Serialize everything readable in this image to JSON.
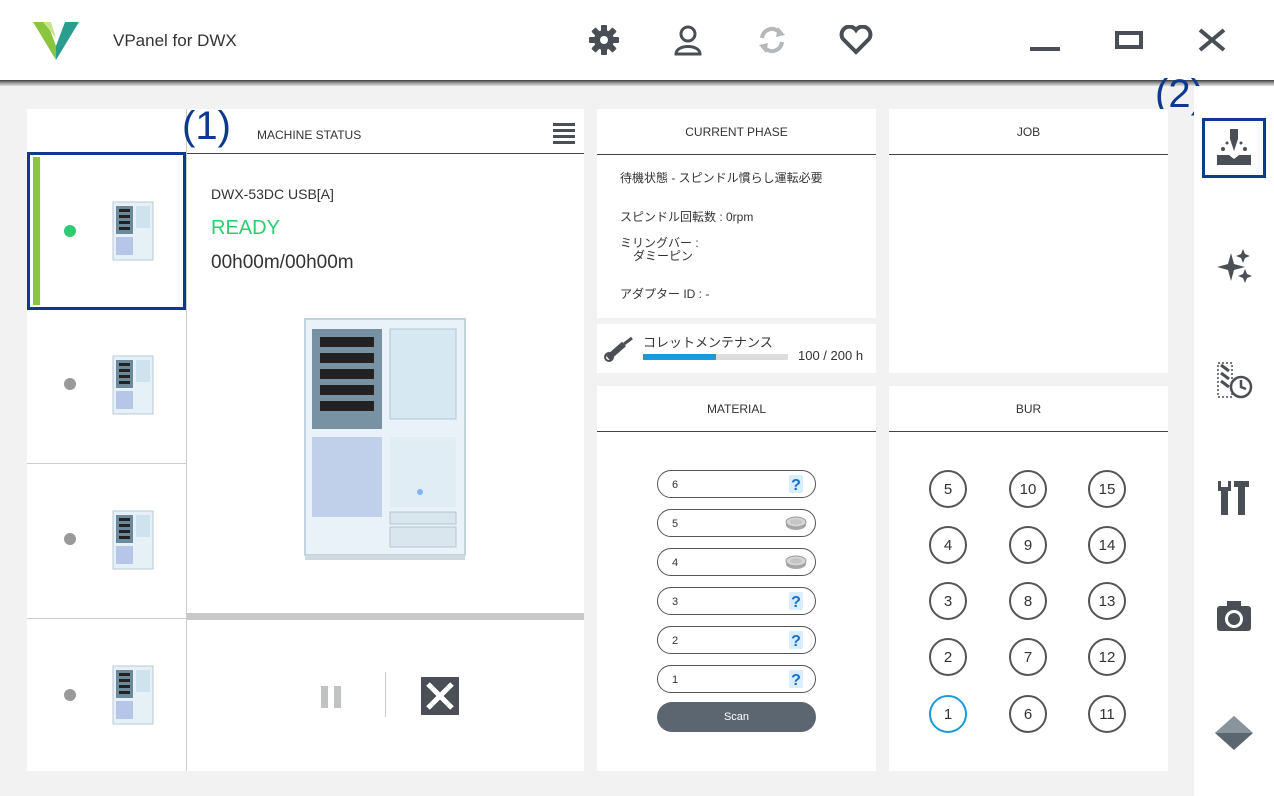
{
  "app": {
    "title": "VPanel for DWX"
  },
  "annotations": {
    "one": "(1)",
    "two": "(2)"
  },
  "toolbar": {
    "icons": [
      "gear-icon",
      "user-icon",
      "sync-icon",
      "heart-icon"
    ]
  },
  "window_controls": [
    "minimize-icon",
    "maximize-icon",
    "close-icon"
  ],
  "machine_status": {
    "title": "MACHINE STATUS",
    "model": "DWX-53DC USB[A]",
    "state": "READY",
    "state_color": "#2ecc71",
    "time": "00h00m/00h00m",
    "progress": 0
  },
  "machines": [
    {
      "status": "active",
      "color": "#2ecc71"
    },
    {
      "status": "idle",
      "color": "#9a9a9a"
    },
    {
      "status": "idle",
      "color": "#9a9a9a"
    },
    {
      "status": "idle",
      "color": "#9a9a9a"
    }
  ],
  "current_phase": {
    "title": "CURRENT PHASE",
    "state": "待機状態 - スピンドル慣らし運転必要",
    "spindle": "スピンドル回転数 : 0rpm",
    "milling_bar_label": "ミリングバー :",
    "milling_bar_value": "ダミーピン",
    "adapter": "アダプター ID : -"
  },
  "collet": {
    "label": "コレットメンテナンス",
    "value": "100 / 200 h",
    "fraction": 0.5
  },
  "job": {
    "title": "JOB"
  },
  "material": {
    "title": "MATERIAL",
    "slots": [
      {
        "num": "6",
        "icon": "question-icon"
      },
      {
        "num": "5",
        "icon": "disc-icon"
      },
      {
        "num": "4",
        "icon": "disc-icon"
      },
      {
        "num": "3",
        "icon": "question-icon"
      },
      {
        "num": "2",
        "icon": "question-icon"
      },
      {
        "num": "1",
        "icon": "question-icon"
      }
    ],
    "scan_label": "Scan"
  },
  "bur": {
    "title": "BUR",
    "columns": [
      [
        "5",
        "4",
        "3",
        "2",
        "1"
      ],
      [
        "10",
        "9",
        "8",
        "7",
        "6"
      ],
      [
        "15",
        "14",
        "13",
        "12",
        "11"
      ]
    ],
    "active": "1",
    "active_color": "#1a9ad9"
  },
  "sidebar": {
    "icons": [
      "milling-icon",
      "sparkle-icon",
      "bur-schedule-icon",
      "tools-icon",
      "camera-icon",
      "diamond-icon"
    ]
  },
  "colors": {
    "accent": "#0d3a8f",
    "green": "#8bc53f",
    "blue": "#1a9ad9"
  }
}
